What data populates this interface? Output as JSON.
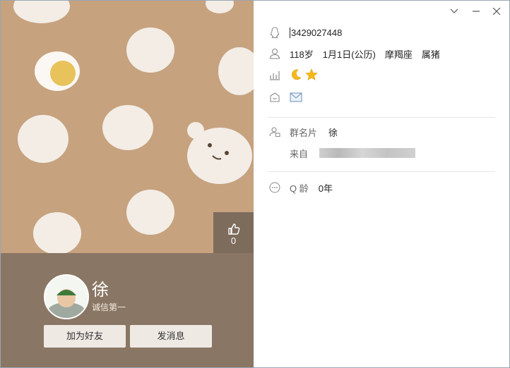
{
  "profile": {
    "nickname": "徐",
    "signature": "诚信第一",
    "likes": "0",
    "add_friend_label": "加为好友",
    "send_message_label": "发消息"
  },
  "info": {
    "qq_number": "3429027448",
    "age": "118岁",
    "birthday": "1月1日(公历)",
    "zodiac": "摩羯座",
    "chinese_zodiac": "属猪",
    "group_card_label": "群名片",
    "group_card_value": "徐",
    "from_label": "来自",
    "q_age_label": "Q 龄",
    "q_age_value": "0年"
  },
  "window_controls": [
    "chevron-down-icon",
    "minimize-icon",
    "close-icon"
  ],
  "colors": {
    "background_left": "#c6a27f",
    "panel": "#8a7664",
    "bun": "#f3ede6"
  }
}
